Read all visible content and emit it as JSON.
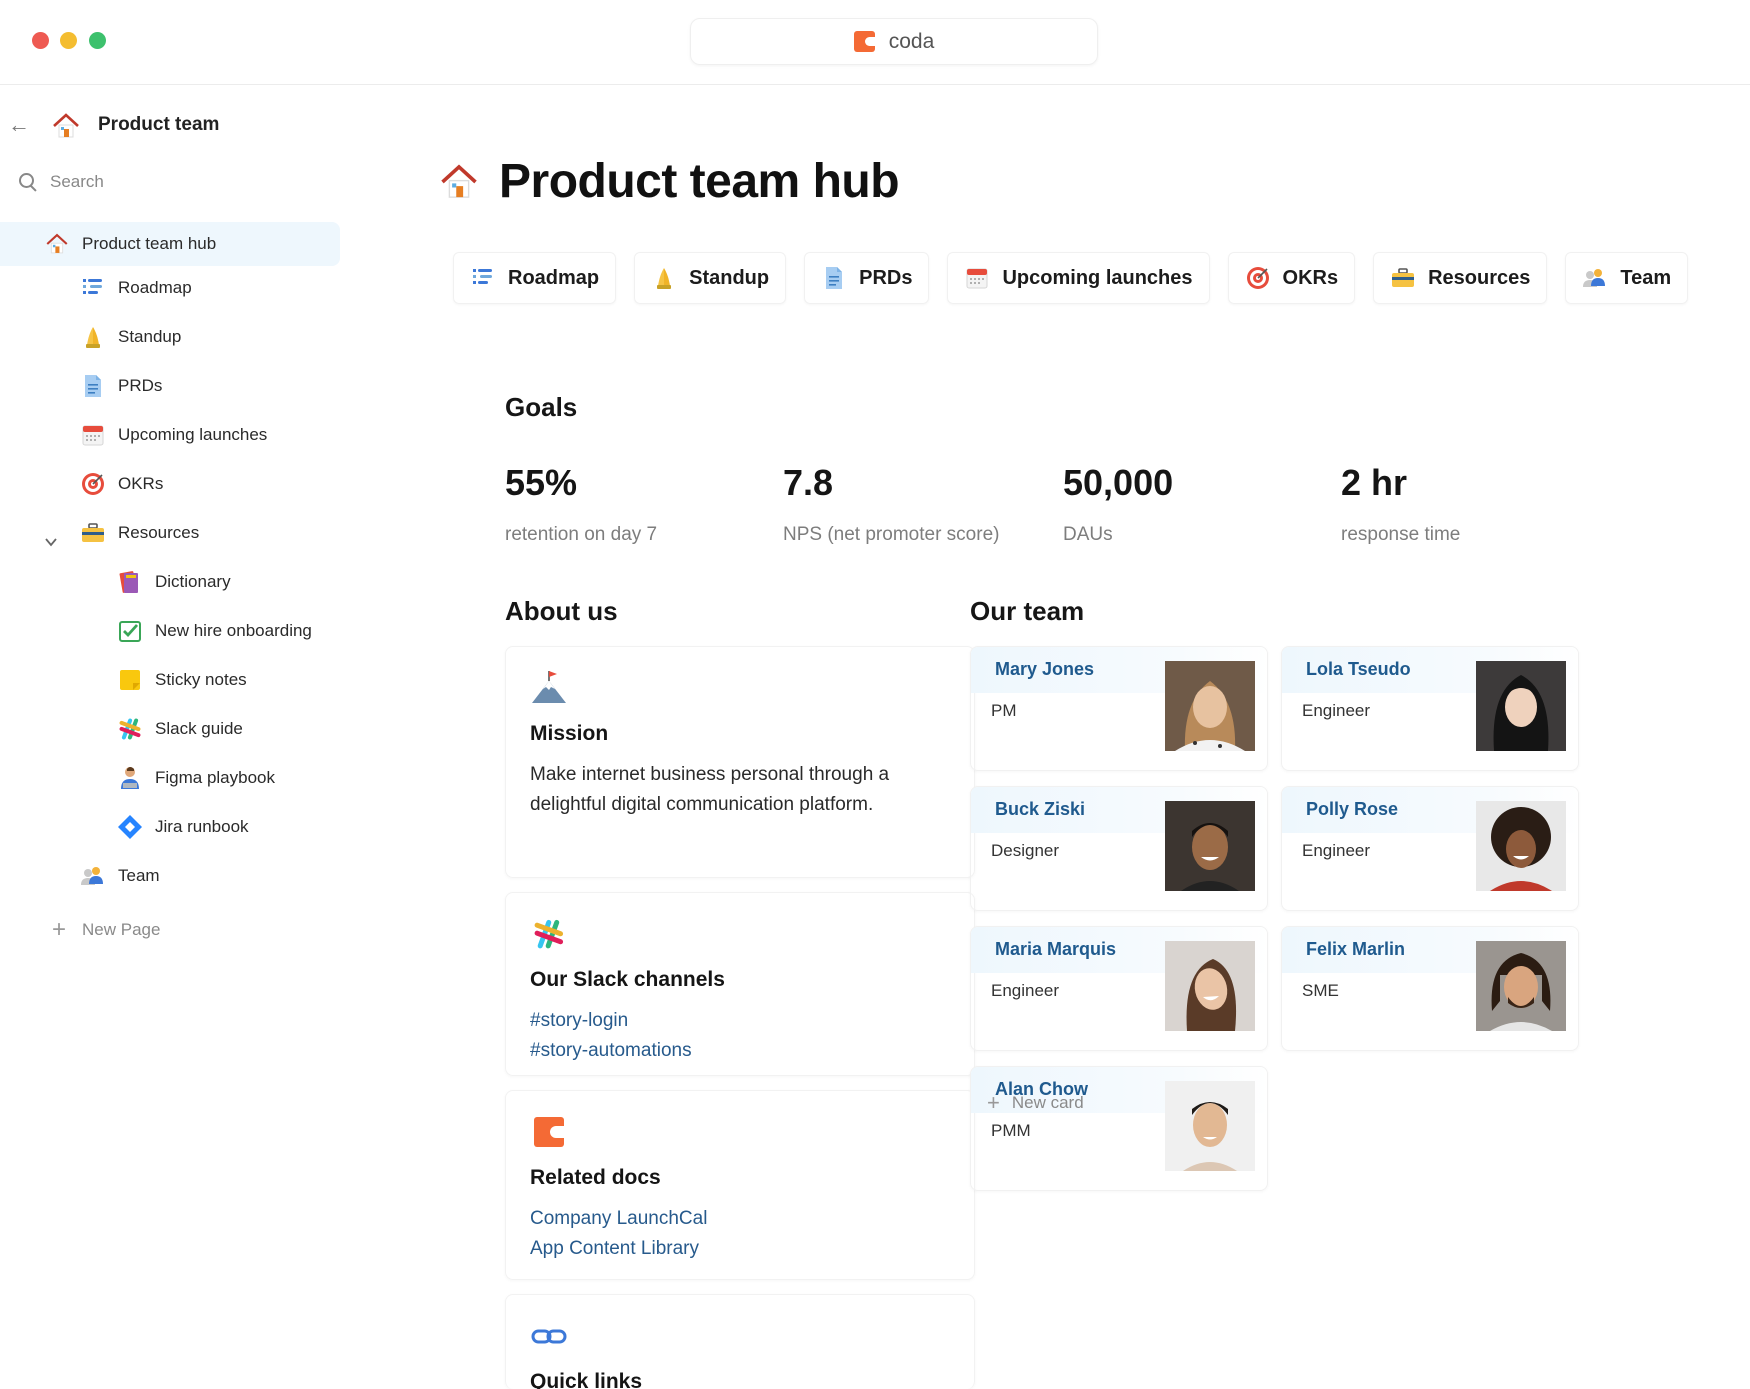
{
  "window": {
    "app_name": "coda"
  },
  "sidebar": {
    "doc_title": "Product team",
    "search_placeholder": "Search",
    "items": [
      {
        "label": "Product team hub",
        "icon": "house-icon"
      },
      {
        "label": "Roadmap",
        "icon": "roadmap-icon"
      },
      {
        "label": "Standup",
        "icon": "praying-hands-icon"
      },
      {
        "label": "PRDs",
        "icon": "document-icon"
      },
      {
        "label": "Upcoming launches",
        "icon": "calendar-icon"
      },
      {
        "label": "OKRs",
        "icon": "target-icon"
      },
      {
        "label": "Resources",
        "icon": "toolbox-icon"
      },
      {
        "label": "Dictionary",
        "icon": "books-icon"
      },
      {
        "label": "New hire onboarding",
        "icon": "checkbox-icon"
      },
      {
        "label": "Sticky notes",
        "icon": "sticky-note-icon"
      },
      {
        "label": "Slack guide",
        "icon": "slack-icon"
      },
      {
        "label": "Figma playbook",
        "icon": "person-laptop-icon"
      },
      {
        "label": "Jira runbook",
        "icon": "jira-icon"
      },
      {
        "label": "Team",
        "icon": "people-icon"
      }
    ],
    "new_page_label": "New Page"
  },
  "page": {
    "title": "Product team hub",
    "tabs": [
      {
        "label": "Roadmap",
        "icon": "roadmap-icon"
      },
      {
        "label": "Standup",
        "icon": "praying-hands-icon"
      },
      {
        "label": "PRDs",
        "icon": "document-icon"
      },
      {
        "label": "Upcoming launches",
        "icon": "calendar-icon"
      },
      {
        "label": "OKRs",
        "icon": "target-icon"
      },
      {
        "label": "Resources",
        "icon": "toolbox-icon"
      },
      {
        "label": "Team",
        "icon": "people-icon"
      }
    ],
    "goals": {
      "heading": "Goals",
      "stats": [
        {
          "value": "55%",
          "label": "retention on day 7"
        },
        {
          "value": "7.8",
          "label": "NPS (net promoter score)"
        },
        {
          "value": "50,000",
          "label": "DAUs"
        },
        {
          "value": "2 hr",
          "label": "response time"
        }
      ]
    },
    "about": {
      "heading": "About us",
      "mission": {
        "title": "Mission",
        "text": "Make internet business personal through a delightful digital communication platform.",
        "icon": "mountain-flag-icon"
      },
      "slack": {
        "title": "Our Slack channels",
        "links": [
          "#story-login",
          "#story-automations"
        ],
        "icon": "slack-icon"
      },
      "related": {
        "title": "Related docs",
        "links": [
          "Company LaunchCal",
          "App Content Library"
        ],
        "icon": "coda-icon"
      },
      "quick": {
        "title": "Quick links",
        "icon": "link-icon"
      }
    },
    "team": {
      "heading": "Our team",
      "members": [
        {
          "name": "Mary Jones",
          "role": "PM"
        },
        {
          "name": "Lola Tseudo",
          "role": "Engineer"
        },
        {
          "name": "Buck Ziski",
          "role": "Designer"
        },
        {
          "name": "Polly Rose",
          "role": "Engineer"
        },
        {
          "name": "Maria Marquis",
          "role": "Engineer"
        },
        {
          "name": "Felix Marlin",
          "role": "SME"
        },
        {
          "name": "Alan Chow",
          "role": "PMM"
        }
      ],
      "new_card_label": "New card"
    }
  },
  "colors": {
    "accent_link": "#275a8c",
    "name_blue": "#1f5a8e",
    "active_nav_bg": "#eef7fd",
    "coda_orange": "#f46a35"
  }
}
